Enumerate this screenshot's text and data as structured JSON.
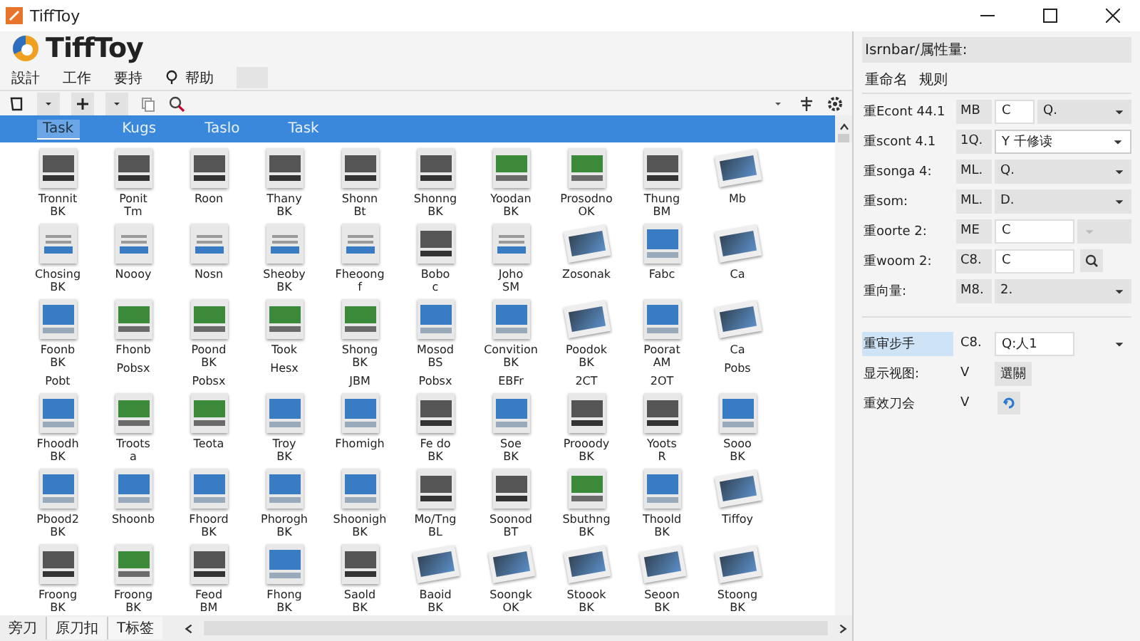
{
  "window": {
    "title": "TiffToy"
  },
  "app": {
    "logo_text": "TiffToy"
  },
  "menu": [
    {
      "label": "設計",
      "icon": false
    },
    {
      "label": "工作",
      "icon": false
    },
    {
      "label": "要持",
      "icon": false
    },
    {
      "label": "帮助",
      "icon": true
    }
  ],
  "tabs": [
    {
      "label": "Task",
      "selected": true
    },
    {
      "label": "Kugs",
      "selected": false
    },
    {
      "label": "Taslo",
      "selected": false
    },
    {
      "label": "Task",
      "selected": false
    }
  ],
  "files": [
    {
      "kind": "dark",
      "lines": [
        "Tronnit",
        "BK"
      ]
    },
    {
      "kind": "dark",
      "lines": [
        "Ponit",
        "Tm"
      ]
    },
    {
      "kind": "dark",
      "lines": [
        "Roon"
      ]
    },
    {
      "kind": "dark",
      "lines": [
        "Thany",
        "BK"
      ]
    },
    {
      "kind": "dark",
      "lines": [
        "Shonn",
        "Bt"
      ]
    },
    {
      "kind": "dark",
      "lines": [
        "Shonng",
        "BK"
      ]
    },
    {
      "kind": "green",
      "lines": [
        "Yoodan",
        "BK"
      ]
    },
    {
      "kind": "green",
      "lines": [
        "Prosodno",
        "OK"
      ]
    },
    {
      "kind": "dark",
      "lines": [
        "Thung",
        "BM"
      ]
    },
    {
      "kind": "tilted",
      "lines": [
        "Mb"
      ]
    },
    {
      "kind": "doc",
      "lines": [
        "Chosing",
        "BK"
      ]
    },
    {
      "kind": "doc",
      "lines": [
        "Noooy"
      ]
    },
    {
      "kind": "doc",
      "lines": [
        "Nosn"
      ]
    },
    {
      "kind": "doc",
      "lines": [
        "Sheoby",
        "BK"
      ]
    },
    {
      "kind": "doc",
      "lines": [
        "Fheoong",
        "f"
      ]
    },
    {
      "kind": "dark",
      "lines": [
        "Bobo",
        "c"
      ]
    },
    {
      "kind": "doc",
      "lines": [
        "Joho",
        "SM"
      ]
    },
    {
      "kind": "tilted",
      "lines": [
        "Zosonak"
      ]
    },
    {
      "kind": "blue",
      "lines": [
        "Fabc"
      ]
    },
    {
      "kind": "tilted",
      "lines": [
        "Ca"
      ]
    },
    {
      "kind": "blue",
      "lines": [
        "Foonb",
        "BK"
      ],
      "tag": "Pobt"
    },
    {
      "kind": "green",
      "lines": [
        "Fhonb"
      ],
      "tag": "Pobsx"
    },
    {
      "kind": "green",
      "lines": [
        "Poond",
        "BK"
      ],
      "tag": "Pobsx"
    },
    {
      "kind": "green",
      "lines": [
        "Took"
      ],
      "tag": "Hesx"
    },
    {
      "kind": "green",
      "lines": [
        "Shong",
        "BK"
      ],
      "tag": "JBM"
    },
    {
      "kind": "blue",
      "lines": [
        "Mosod",
        "BS"
      ],
      "tag": "Pobsx"
    },
    {
      "kind": "blue",
      "lines": [
        "Convition",
        "BK"
      ],
      "tag": "EBFr"
    },
    {
      "kind": "tilted",
      "lines": [
        "Poodok",
        "BK"
      ],
      "tag": "2CT"
    },
    {
      "kind": "blue",
      "lines": [
        "Poorat",
        "AM"
      ],
      "tag": "2OT"
    },
    {
      "kind": "tilted",
      "lines": [
        "Ca"
      ],
      "tag": "Pobs"
    },
    {
      "kind": "blue",
      "lines": [
        "Fhoodh",
        "BK"
      ]
    },
    {
      "kind": "green",
      "lines": [
        "Troots",
        "a"
      ]
    },
    {
      "kind": "green",
      "lines": [
        "Teota"
      ]
    },
    {
      "kind": "blue",
      "lines": [
        "Troy",
        "BK"
      ]
    },
    {
      "kind": "blue",
      "lines": [
        "Fhomigh"
      ]
    },
    {
      "kind": "dark",
      "lines": [
        "Fe do",
        "BK"
      ]
    },
    {
      "kind": "blue",
      "lines": [
        "Soe",
        "BK"
      ]
    },
    {
      "kind": "dark",
      "lines": [
        "Prooody",
        "BK"
      ]
    },
    {
      "kind": "dark",
      "lines": [
        "Yoots",
        "R"
      ]
    },
    {
      "kind": "blue",
      "lines": [
        "Sooo",
        "BK"
      ]
    },
    {
      "kind": "blue",
      "lines": [
        "Pbood2",
        "BK"
      ]
    },
    {
      "kind": "blue",
      "lines": [
        "Shoonb"
      ]
    },
    {
      "kind": "blue",
      "lines": [
        "Fhoord",
        "BK"
      ]
    },
    {
      "kind": "blue",
      "lines": [
        "Phorogh",
        "BK"
      ]
    },
    {
      "kind": "blue",
      "lines": [
        "Shoonigh",
        "BK"
      ]
    },
    {
      "kind": "dark",
      "lines": [
        "Mo/Tng",
        "BL"
      ]
    },
    {
      "kind": "dark",
      "lines": [
        "Soonod",
        "BT"
      ]
    },
    {
      "kind": "green",
      "lines": [
        "Sbuthng",
        "BK"
      ]
    },
    {
      "kind": "blue",
      "lines": [
        "Thoold",
        "BK"
      ]
    },
    {
      "kind": "tilted",
      "lines": [
        "Tiffoy"
      ]
    },
    {
      "kind": "dark",
      "lines": [
        "Froong",
        "BK"
      ]
    },
    {
      "kind": "green",
      "lines": [
        "Froong",
        "BK"
      ]
    },
    {
      "kind": "dark",
      "lines": [
        "Feod",
        "BM"
      ]
    },
    {
      "kind": "blue",
      "lines": [
        "Fhong",
        "BK"
      ]
    },
    {
      "kind": "dark",
      "lines": [
        "Saold",
        "BK"
      ]
    },
    {
      "kind": "tilted",
      "lines": [
        "Baoid",
        "BK"
      ]
    },
    {
      "kind": "tilted",
      "lines": [
        "Soongk",
        "OK"
      ]
    },
    {
      "kind": "tilted",
      "lines": [
        "Stoook",
        "BK"
      ]
    },
    {
      "kind": "tilted",
      "lines": [
        "Seoon",
        "BK"
      ]
    },
    {
      "kind": "tilted",
      "lines": [
        "Stoong",
        "BK"
      ]
    }
  ],
  "status_tabs": [
    {
      "label": "旁刀",
      "selected": true
    },
    {
      "label": "原刀扣",
      "selected": false
    },
    {
      "label": "T标签",
      "selected": false
    }
  ],
  "panel": {
    "title": "Isrnbar/属性量:",
    "tabs": [
      "重命名",
      "规则"
    ],
    "rows": [
      {
        "label": "重Econt 44.1",
        "code": "MB",
        "kind": "input_dropdown",
        "input": "C",
        "value": "Q."
      },
      {
        "label": "重scont 4.1",
        "code": "1Q.",
        "kind": "dropdown",
        "value": "Y 千修读",
        "disabled": false
      },
      {
        "label": "重songa 4:",
        "code": "ML.",
        "kind": "dropdown",
        "value": "Q.",
        "disabled": true
      },
      {
        "label": "重som:",
        "code": "ML.",
        "kind": "dropdown",
        "value": "D.",
        "disabled": true
      },
      {
        "label": "重oorte 2:",
        "code": "ME",
        "kind": "input_disabled",
        "input": "C"
      },
      {
        "label": "重woom 2:",
        "code": "C8.",
        "kind": "input_search",
        "input": "C"
      },
      {
        "label": "重向量:",
        "code": "M8.",
        "kind": "dropdown",
        "value": "2.",
        "disabled": true
      }
    ],
    "options": [
      {
        "label": "重审步手",
        "code": "C8.",
        "kind": "input_caret",
        "input": "Q:人1",
        "selected": true
      },
      {
        "label": "显示视图:",
        "code": "V",
        "kind": "button",
        "button": "選關",
        "selected": false
      },
      {
        "label": "重效刀会",
        "code": "V",
        "kind": "refresh",
        "selected": false
      }
    ]
  }
}
